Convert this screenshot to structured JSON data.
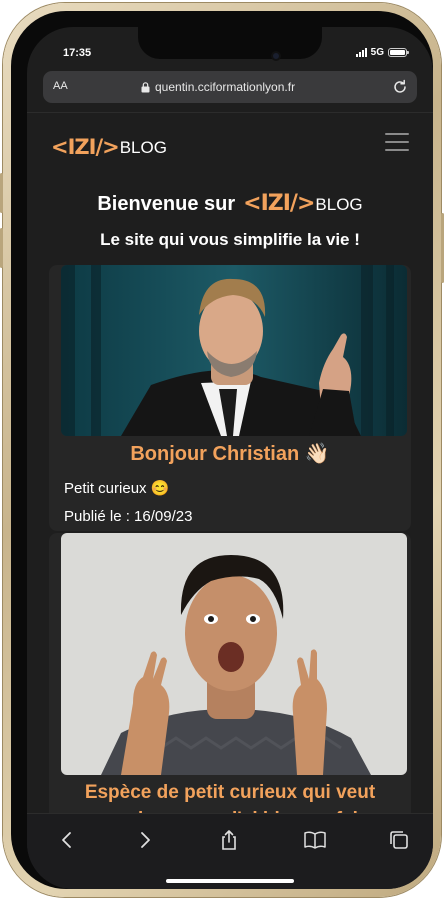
{
  "status": {
    "time": "17:35",
    "network": "5G"
  },
  "browser": {
    "text_size_label": "AA",
    "url": "quentin.cciformationlyon.fr"
  },
  "site": {
    "logo_code": "<IZI/>",
    "logo_suffix": "BLOG",
    "welcome_prefix": "Bienvenue sur",
    "tagline": "Le site qui vous simplifie la vie !"
  },
  "posts": [
    {
      "title": "Bonjour Christian 👋🏻",
      "excerpt": "Petit curieux 😊",
      "date_label": "Publié le : 16/09/23"
    },
    {
      "title": "Espèce de petit curieux qui veut regarder ce que j'ai bien pu faire"
    }
  ],
  "toolbar_icons": [
    "back-icon",
    "forward-icon",
    "share-icon",
    "bookmarks-icon",
    "tabs-icon"
  ],
  "colors": {
    "accent": "#f2a25c",
    "background": "#1e1e1e",
    "card": "#262626"
  }
}
